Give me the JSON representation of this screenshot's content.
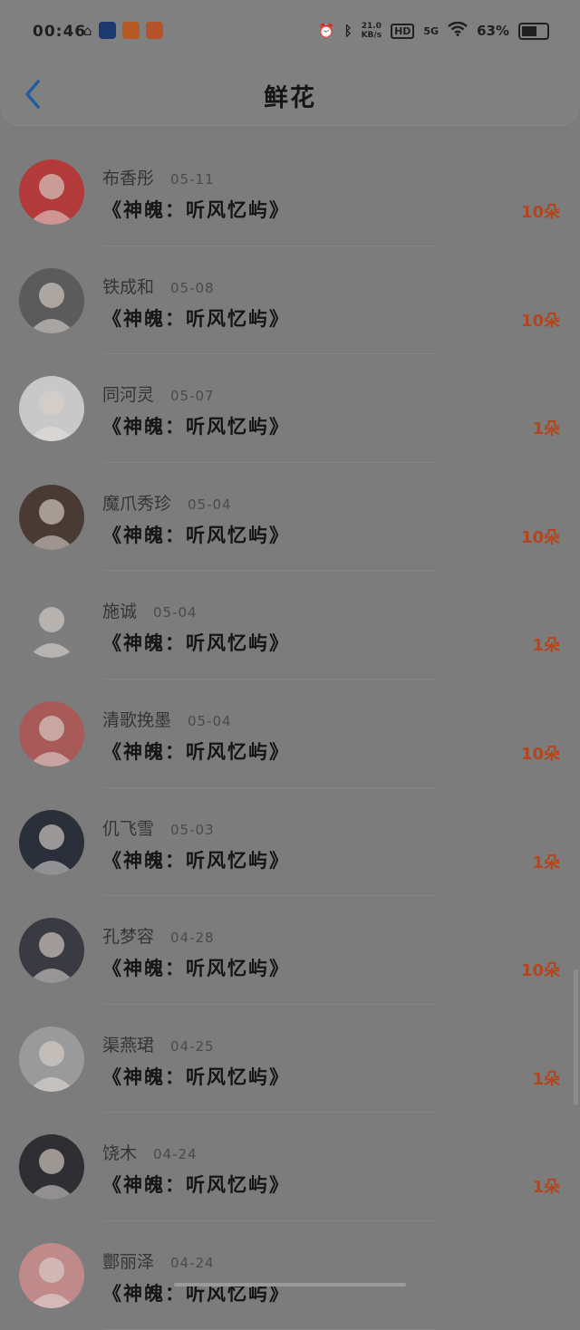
{
  "status_bar": {
    "time": "00:46",
    "net_speed_value": "21.0",
    "net_speed_unit": "KB/s",
    "hd": "HD",
    "network": "5G",
    "battery": "63%",
    "battery_level": 0.63
  },
  "header": {
    "title": "鲜花"
  },
  "records": [
    {
      "name": "布香彤",
      "date": "05-11",
      "book": "《神魄：听风忆屿》",
      "count": "10朵",
      "avatar_color": "#b23a3a"
    },
    {
      "name": "铁成和",
      "date": "05-08",
      "book": "《神魄：听风忆屿》",
      "count": "10朵",
      "avatar_color": "#5b5b5b"
    },
    {
      "name": "同河灵",
      "date": "05-07",
      "book": "《神魄：听风忆屿》",
      "count": "1朵",
      "avatar_color": "#c8c8c8"
    },
    {
      "name": "魔爪秀珍",
      "date": "05-04",
      "book": "《神魄：听风忆屿》",
      "count": "10朵",
      "avatar_color": "#4a3a34"
    },
    {
      "name": "施诚",
      "date": "05-04",
      "book": "《神魄：听风忆屿》",
      "count": "1朵",
      "avatar_color": "#7d7d7d"
    },
    {
      "name": "清歌挽墨",
      "date": "05-04",
      "book": "《神魄：听风忆屿》",
      "count": "10朵",
      "avatar_color": "#a85a58"
    },
    {
      "name": "仉飞雪",
      "date": "05-03",
      "book": "《神魄：听风忆屿》",
      "count": "1朵",
      "avatar_color": "#2b2f3a"
    },
    {
      "name": "孔梦容",
      "date": "04-28",
      "book": "《神魄：听风忆屿》",
      "count": "10朵",
      "avatar_color": "#3a3a42"
    },
    {
      "name": "渠燕珺",
      "date": "04-25",
      "book": "《神魄：听风忆屿》",
      "count": "1朵",
      "avatar_color": "#9a9a9a"
    },
    {
      "name": "饶木",
      "date": "04-24",
      "book": "《神魄：听风忆屿》",
      "count": "1朵",
      "avatar_color": "#2e2e33"
    },
    {
      "name": "酆丽泽",
      "date": "04-24",
      "book": "《神魄：听风忆屿》",
      "count": "",
      "avatar_color": "#c08a8a"
    }
  ]
}
